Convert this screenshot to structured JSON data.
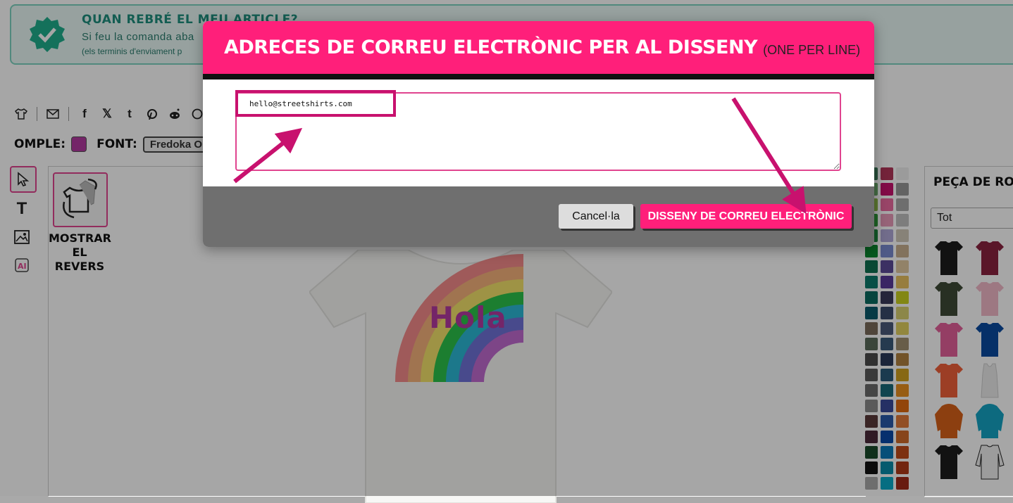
{
  "banner": {
    "title": "QUAN REBRÉ EL MEU ARTICLE?",
    "line1": "Si feu la comanda aba",
    "line2": "(els terminis d'enviament p"
  },
  "share": {
    "icons": [
      "tshirt-icon",
      "email-icon",
      "facebook-icon",
      "x-icon",
      "tumblr-icon",
      "pinterest-icon",
      "reddit-icon",
      "whatsapp-icon"
    ]
  },
  "toolbar": {
    "fill_label": "OMPLE:",
    "fill_color": "#b23aa0",
    "font_label": "FONT:",
    "font_value": "Fredoka On"
  },
  "tools": [
    "select-tool-icon",
    "text-tool-icon",
    "image-tool-icon",
    "ai-tool-icon"
  ],
  "canvas": {
    "flip_label_1": "MOSTRAR",
    "flip_label_2": "EL REVERS",
    "design_text": "Hola"
  },
  "products": {
    "title": "PEÇA DE ROBA",
    "filter_value": "Tot"
  },
  "modal": {
    "title": "ADRECES DE CORREU ELECTRÒNIC PER AL DISSENY",
    "subtitle": "(ONE PER LINE)",
    "email_value": "hello@streetshirts.com",
    "cancel_label": "Cancel·la",
    "submit_label": "DISSENY DE CORREU ELECTRÒNIC"
  },
  "colors": {
    "accent": "#ff1f7a",
    "annotation": "#c8116e",
    "banner_text": "#1e8f7e"
  }
}
